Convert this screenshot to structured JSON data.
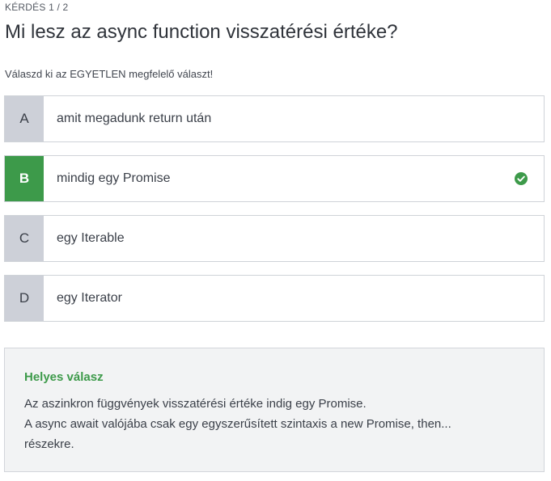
{
  "header": {
    "counter": "KÉRDÉS 1 / 2",
    "question": "Mi lesz az async function visszatérési értéke?",
    "instruction": "Válaszd ki az EGYETLEN megfelelő választ!"
  },
  "answers": [
    {
      "letter": "A",
      "text": "amit megadunk return után",
      "correct": false
    },
    {
      "letter": "B",
      "text": "mindig egy Promise",
      "correct": true
    },
    {
      "letter": "C",
      "text": "egy Iterable",
      "correct": false
    },
    {
      "letter": "D",
      "text": "egy Iterator",
      "correct": false
    }
  ],
  "feedback": {
    "title": "Helyes válasz",
    "lines": [
      "Az aszinkron függvények visszatérési értéke indig egy Promise.",
      "A async await valójába csak egy egyszerűsített szintaxis a new Promise, then...",
      "részekre."
    ]
  },
  "colors": {
    "correct": "#3d9a4a",
    "letter_bg": "#cdd0d8",
    "feedback_bg": "#f2f3f4"
  },
  "icons": {
    "correct_answer": "check-circle-icon"
  }
}
